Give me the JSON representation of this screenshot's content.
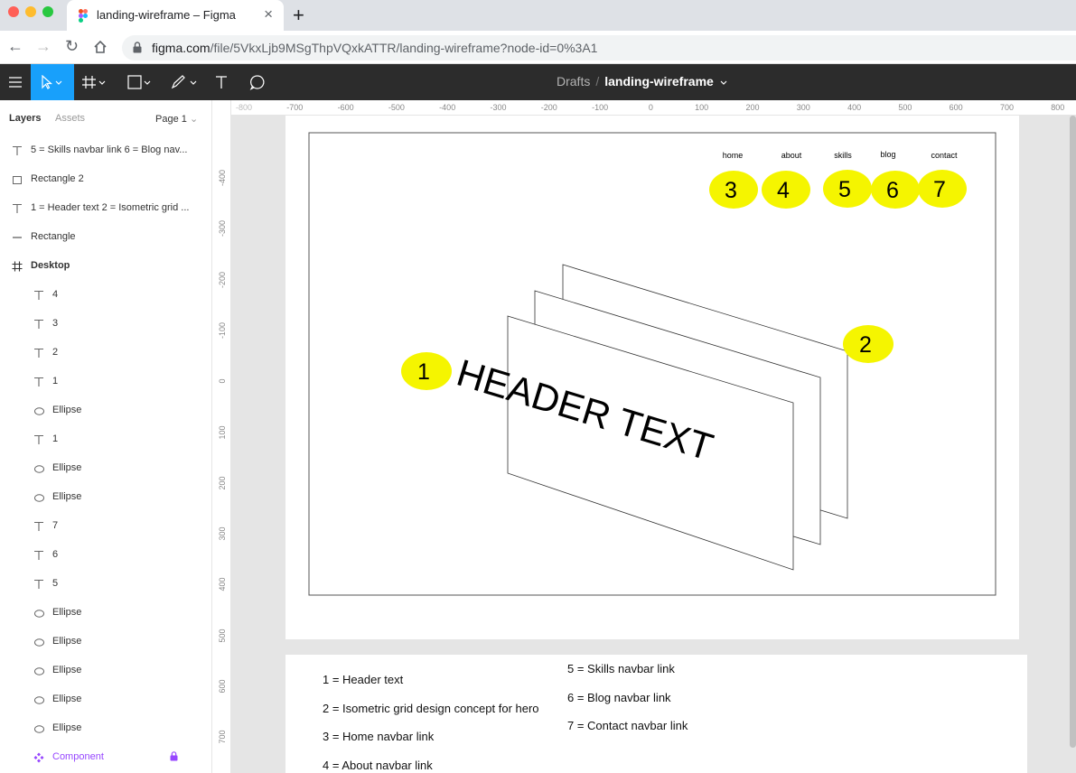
{
  "browser": {
    "tab_title": "landing-wireframe – Figma",
    "url_domain": "figma.com",
    "url_path": "/file/5VkxLjb9MSgThpVQxkATTR/landing-wireframe?node-id=0%3A1"
  },
  "toolbar": {
    "breadcrumb_drafts": "Drafts",
    "breadcrumb_sep": "/",
    "file_name": "landing-wireframe"
  },
  "left_panel": {
    "tab_layers": "Layers",
    "tab_assets": "Assets",
    "page": "Page 1",
    "layers": [
      {
        "icon": "text-icon",
        "name": "5 = Skills navbar link 6 = Blog nav..."
      },
      {
        "icon": "rectangle-icon",
        "name": "Rectangle 2"
      },
      {
        "icon": "text-icon",
        "name": "1 = Header text 2 = Isometric grid ..."
      },
      {
        "icon": "line-icon",
        "name": "Rectangle"
      },
      {
        "icon": "frame-icon",
        "name": "Desktop"
      },
      {
        "icon": "text-icon",
        "name": "4"
      },
      {
        "icon": "text-icon",
        "name": "3"
      },
      {
        "icon": "text-icon",
        "name": "2"
      },
      {
        "icon": "text-icon",
        "name": "1"
      },
      {
        "icon": "ellipse-icon",
        "name": "Ellipse"
      },
      {
        "icon": "text-icon",
        "name": "1"
      },
      {
        "icon": "ellipse-icon",
        "name": "Ellipse"
      },
      {
        "icon": "ellipse-icon",
        "name": "Ellipse"
      },
      {
        "icon": "text-icon",
        "name": "7"
      },
      {
        "icon": "text-icon",
        "name": "6"
      },
      {
        "icon": "text-icon",
        "name": "5"
      },
      {
        "icon": "ellipse-icon",
        "name": "Ellipse"
      },
      {
        "icon": "ellipse-icon",
        "name": "Ellipse"
      },
      {
        "icon": "ellipse-icon",
        "name": "Ellipse"
      },
      {
        "icon": "ellipse-icon",
        "name": "Ellipse"
      },
      {
        "icon": "ellipse-icon",
        "name": "Ellipse"
      },
      {
        "icon": "component-icon",
        "name": "Component"
      }
    ]
  },
  "ruler": {
    "top": [
      "-800",
      "-700",
      "-600",
      "-500",
      "-400",
      "-300",
      "-200",
      "-100",
      "0",
      "100",
      "200",
      "300",
      "400",
      "500",
      "600",
      "700",
      "800"
    ],
    "left": [
      "-400",
      "-300",
      "-200",
      "-100",
      "0",
      "100",
      "200",
      "300",
      "400",
      "500",
      "600",
      "700"
    ]
  },
  "wireframe": {
    "nav_links": [
      "home",
      "about",
      "skills",
      "blog",
      "contact"
    ],
    "markers": [
      "1",
      "2",
      "3",
      "4",
      "5",
      "6",
      "7"
    ],
    "header_text": "HEADER TEXT",
    "marker_color": "#f5f500"
  },
  "legend": {
    "left": [
      "1 = Header text",
      "2 = Isometric grid design concept for hero",
      "3 = Home navbar link",
      "4 = About navbar link"
    ],
    "right": [
      "5 = Skills navbar link",
      "6 = Blog navbar link",
      "7 = Contact navbar link"
    ]
  }
}
